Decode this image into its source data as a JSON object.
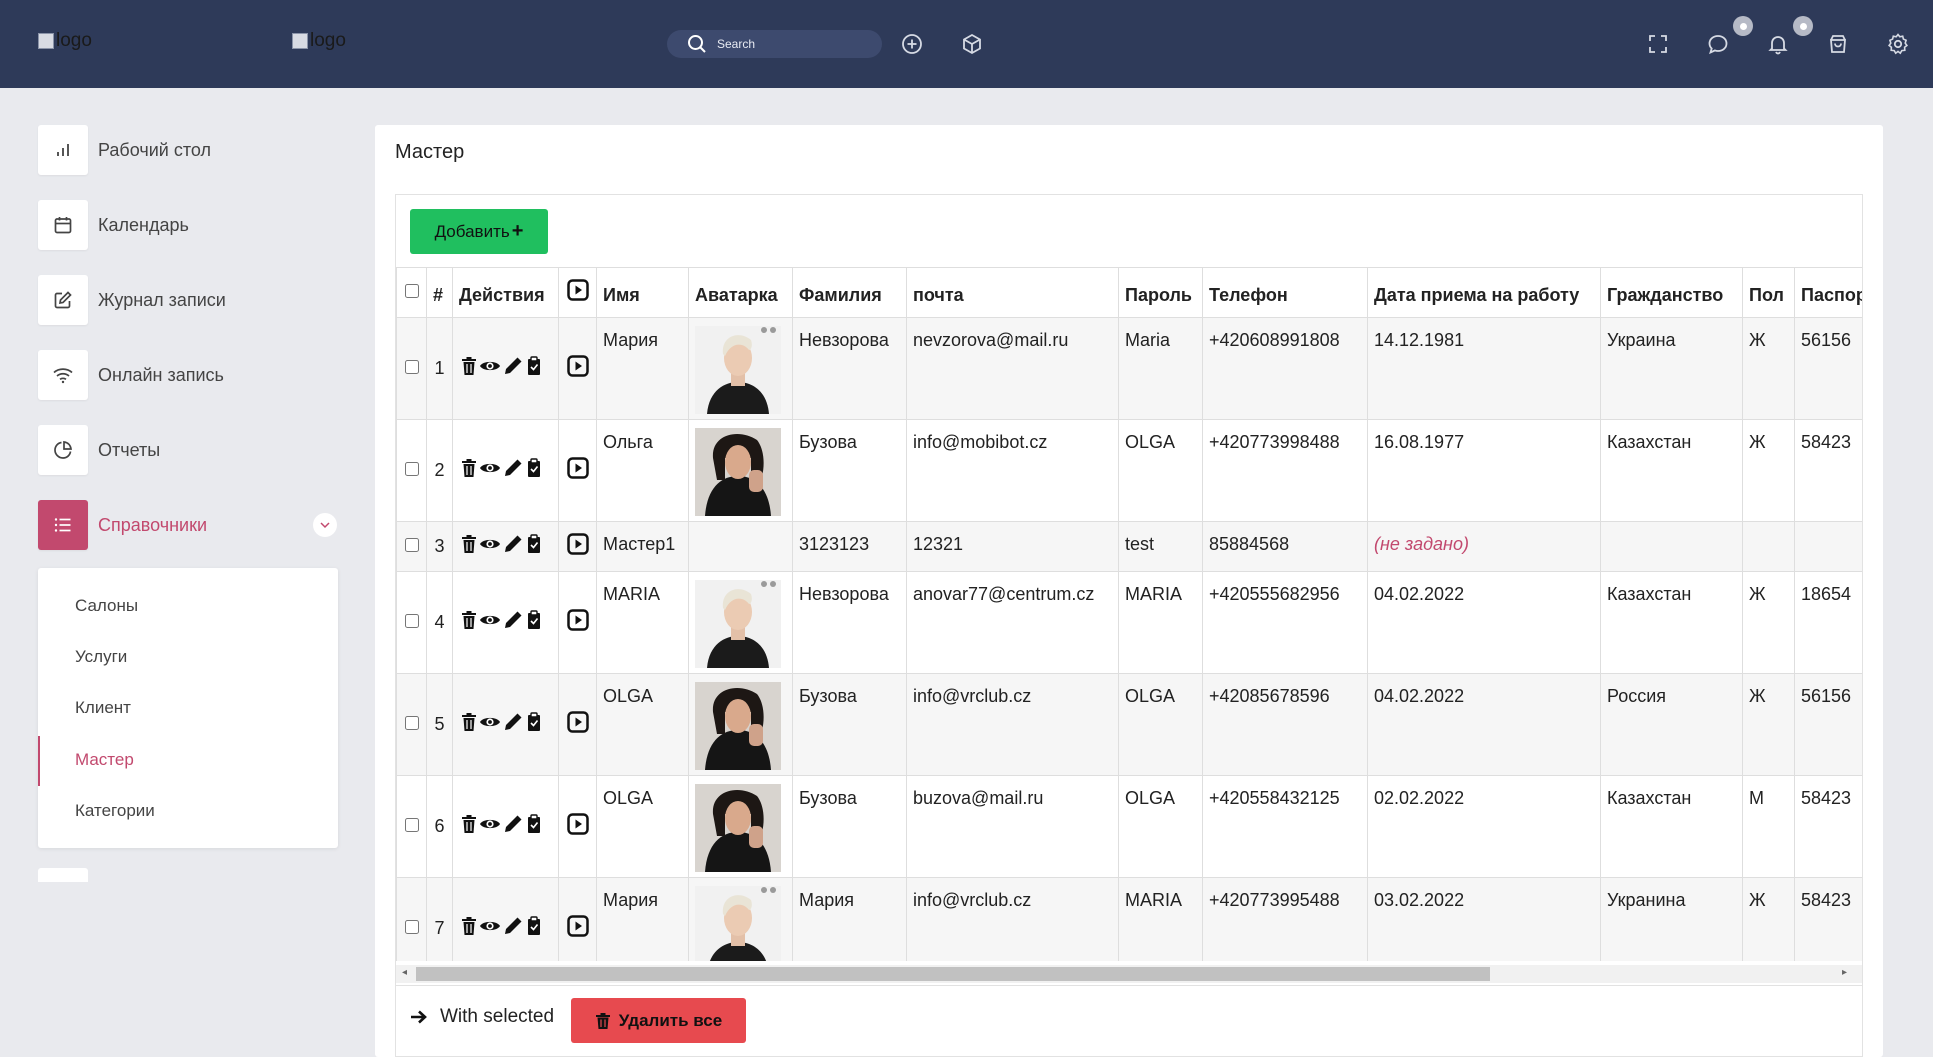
{
  "header": {
    "logos": [
      "logo",
      "logo"
    ],
    "search_placeholder": "Search"
  },
  "sidebar": {
    "items": [
      {
        "label": "Рабочий стол",
        "icon": "bar-chart-icon"
      },
      {
        "label": "Календарь",
        "icon": "calendar-icon"
      },
      {
        "label": "Журнал записи",
        "icon": "edit-icon"
      },
      {
        "label": "Онлайн запись",
        "icon": "wifi-icon"
      },
      {
        "label": "Отчеты",
        "icon": "pie-chart-icon"
      },
      {
        "label": "Справочники",
        "icon": "list-icon",
        "active": true
      }
    ],
    "submenu": [
      {
        "label": "Салоны"
      },
      {
        "label": "Услуги"
      },
      {
        "label": "Клиент"
      },
      {
        "label": "Мастер",
        "active": true
      },
      {
        "label": "Категории"
      }
    ]
  },
  "page": {
    "title": "Мастер",
    "add_label": "Добавить",
    "with_selected": "With selected",
    "delete_all": "Удалить все"
  },
  "table": {
    "headers": [
      "#",
      "Действия",
      "Имя",
      "Аватарка",
      "Фамилия",
      "почта",
      "Пароль",
      "Телефон",
      "Дата приема на работу",
      "Гражданство",
      "Пол",
      "Паспорт"
    ],
    "rows": [
      {
        "n": "1",
        "name": "Мария",
        "avatar": "blonde",
        "surname": "Невзорова",
        "email": "nevzorova@mail.ru",
        "password": "Maria",
        "phone": "+420608991808",
        "date": "14.12.1981",
        "citizenship": "Украина",
        "sex": "Ж",
        "passport": "56156"
      },
      {
        "n": "2",
        "name": "Ольга",
        "avatar": "dark",
        "surname": "Бузова",
        "email": "info@mobibot.cz",
        "password": "OLGA",
        "phone": "+420773998488",
        "date": "16.08.1977",
        "citizenship": "Казахстан",
        "sex": "Ж",
        "passport": "58423"
      },
      {
        "n": "3",
        "name": "Мастер1",
        "avatar": "",
        "surname": "3123123",
        "email": "12321",
        "password": "test",
        "phone": "85884568",
        "date": "(не задано)",
        "citizenship": "",
        "sex": "",
        "passport": ""
      },
      {
        "n": "4",
        "name": "MARIA",
        "avatar": "blonde",
        "surname": "Невзорова",
        "email": "anovar77@centrum.cz",
        "password": "MARIA",
        "phone": "+420555682956",
        "date": "04.02.2022",
        "citizenship": "Казахстан",
        "sex": "Ж",
        "passport": "18654"
      },
      {
        "n": "5",
        "name": "OLGA",
        "avatar": "dark",
        "surname": "Бузова",
        "email": "info@vrclub.cz",
        "password": "OLGA",
        "phone": "+42085678596",
        "date": "04.02.2022",
        "citizenship": "Россия",
        "sex": "Ж",
        "passport": "56156"
      },
      {
        "n": "6",
        "name": "OLGA",
        "avatar": "dark",
        "surname": "Бузова",
        "email": "buzova@mail.ru",
        "password": "OLGA",
        "phone": "+420558432125",
        "date": "02.02.2022",
        "citizenship": "Казахстан",
        "sex": "М",
        "passport": "58423"
      },
      {
        "n": "7",
        "name": "Мария",
        "avatar": "blonde",
        "surname": "Мария",
        "email": "info@vrclub.cz",
        "password": "MARIA",
        "phone": "+420773995488",
        "date": "03.02.2022",
        "citizenship": "Укранина",
        "sex": "Ж",
        "passport": "58423"
      }
    ]
  },
  "colors": {
    "topbar": "#2e3a59",
    "accent": "#c2496e",
    "add_button": "#20bf5f",
    "delete_button": "#e74a4f"
  }
}
